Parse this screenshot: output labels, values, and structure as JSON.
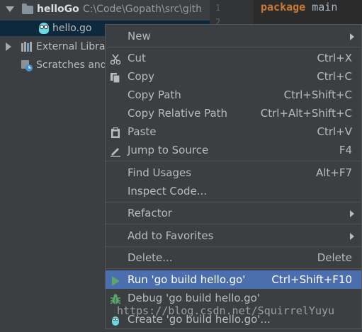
{
  "project_tree": {
    "root": {
      "name": "helloGo",
      "path": "C:\\Code\\Gopath\\src\\gith"
    },
    "file": "hello.go",
    "external_libraries": "External Libra",
    "scratches": "Scratches and"
  },
  "editor": {
    "line_numbers": [
      "1",
      "2"
    ],
    "code": {
      "keyword": "package",
      "identifier": "main"
    }
  },
  "context_menu": {
    "items": {
      "new": {
        "label": "New"
      },
      "cut": {
        "label": "Cut",
        "shortcut": "Ctrl+X"
      },
      "copy": {
        "label": "Copy",
        "shortcut": "Ctrl+C"
      },
      "copy_path": {
        "label": "Copy Path",
        "shortcut": "Ctrl+Shift+C"
      },
      "copy_relative_path": {
        "label": "Copy Relative Path",
        "shortcut": "Ctrl+Alt+Shift+C"
      },
      "paste": {
        "label": "Paste",
        "shortcut": "Ctrl+V"
      },
      "jump_to_source": {
        "label": "Jump to Source",
        "shortcut": "F4"
      },
      "find_usages": {
        "label": "Find Usages",
        "shortcut": "Alt+F7"
      },
      "inspect_code": {
        "label": "Inspect Code..."
      },
      "refactor": {
        "label": "Refactor"
      },
      "add_to_favorites": {
        "label": "Add to Favorites"
      },
      "delete": {
        "label": "Delete...",
        "shortcut": "Delete"
      },
      "run": {
        "label": "Run 'go build hello.go'",
        "shortcut": "Ctrl+Shift+F10"
      },
      "debug": {
        "label": "Debug 'go build hello.go'"
      },
      "create": {
        "label": "Create 'go build hello.go'..."
      }
    }
  },
  "watermark": "https://blog.csdn.net/SquirrelYuyu"
}
